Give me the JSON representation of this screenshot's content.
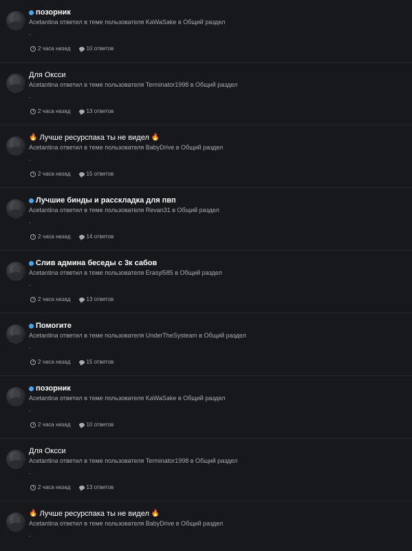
{
  "colors": {
    "background": "#17181b",
    "divider": "#25262a",
    "title": "#ffffff",
    "secondary_text": "#a9abaf",
    "unread_dot": "#4aa6e8",
    "fire_emoji": "#ff7a1a"
  },
  "feed": {
    "items": [
      {
        "title": "позорник",
        "unread": true,
        "fire": false,
        "subline": "Acetantina ответил в теме пользователя KaWaSake в Общий раздел",
        "excerpt": ".",
        "time": "2 часа назад",
        "replies": "10 ответов"
      },
      {
        "title": "Для Оксси",
        "unread": false,
        "fire": false,
        "subline": "Acetantina ответил в теме пользователя Terminator1998 в Общий раздел",
        "excerpt": ".",
        "time": "2 часа назад",
        "replies": "13 ответов"
      },
      {
        "title": "Лучше ресурспака ты не видел",
        "unread": false,
        "fire": true,
        "subline": "Acetantina ответил в теме пользователя BabyDrive в Общий раздел",
        "excerpt": ".",
        "time": "2 часа назад",
        "replies": "15 ответов"
      },
      {
        "title": "Лучшие бинды и расскладка для пвп",
        "unread": true,
        "fire": false,
        "subline": "Acetantina ответил в теме пользователя Revan31 в Общий раздел",
        "excerpt": ".",
        "time": "2 часа назад",
        "replies": "14 ответов"
      },
      {
        "title": "Слив админа беседы с 3к сабов",
        "unread": true,
        "fire": false,
        "subline": "Acetantina ответил в теме пользователя Erasyl585 в Общий раздел",
        "excerpt": ".",
        "time": "2 часа назад",
        "replies": "13 ответов"
      },
      {
        "title": "Помогите",
        "unread": true,
        "fire": false,
        "subline": "Acetantina ответил в теме пользователя UnderTheSysteam в Общий раздел",
        "excerpt": ".",
        "time": "2 часа назад",
        "replies": "15 ответов"
      },
      {
        "title": "позорник",
        "unread": true,
        "fire": false,
        "subline": "Acetantina ответил в теме пользователя KaWaSake в Общий раздел",
        "excerpt": ".",
        "time": "2 часа назад",
        "replies": "10 ответов"
      },
      {
        "title": "Для Оксси",
        "unread": false,
        "fire": false,
        "subline": "Acetantina ответил в теме пользователя Terminator1998 в Общий раздел",
        "excerpt": ".",
        "time": "2 часа назад",
        "replies": "13 ответов"
      },
      {
        "title": "Лучше ресурспака ты не видел",
        "unread": false,
        "fire": true,
        "subline": "Acetantina ответил в теме пользователя BabyDrive в Общий раздел",
        "excerpt": ".",
        "time": "",
        "replies": ""
      }
    ]
  }
}
